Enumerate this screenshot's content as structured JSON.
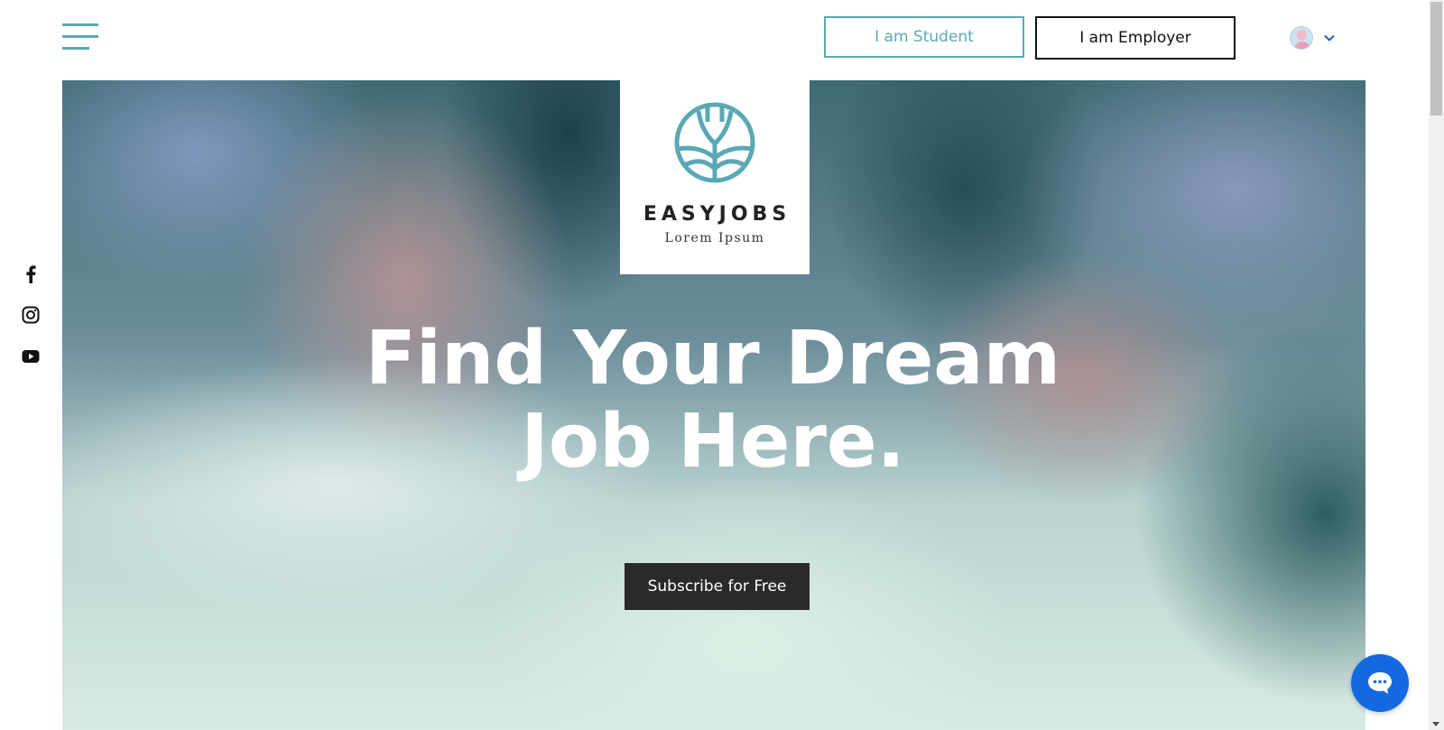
{
  "header": {
    "student_label": "I am Student",
    "employer_label": "I am Employer"
  },
  "logo": {
    "brand": "EASYJOBS",
    "tagline": "Lorem Ipsum"
  },
  "hero": {
    "headline_line1": "Find Your Dream",
    "headline_line2": "Job Here.",
    "cta_label": "Subscribe for Free"
  },
  "social": [
    "facebook-icon",
    "instagram-icon",
    "youtube-icon"
  ],
  "colors": {
    "accent": "#5aa8b4",
    "cta": "#2b2a29",
    "chat": "#1469e0"
  }
}
